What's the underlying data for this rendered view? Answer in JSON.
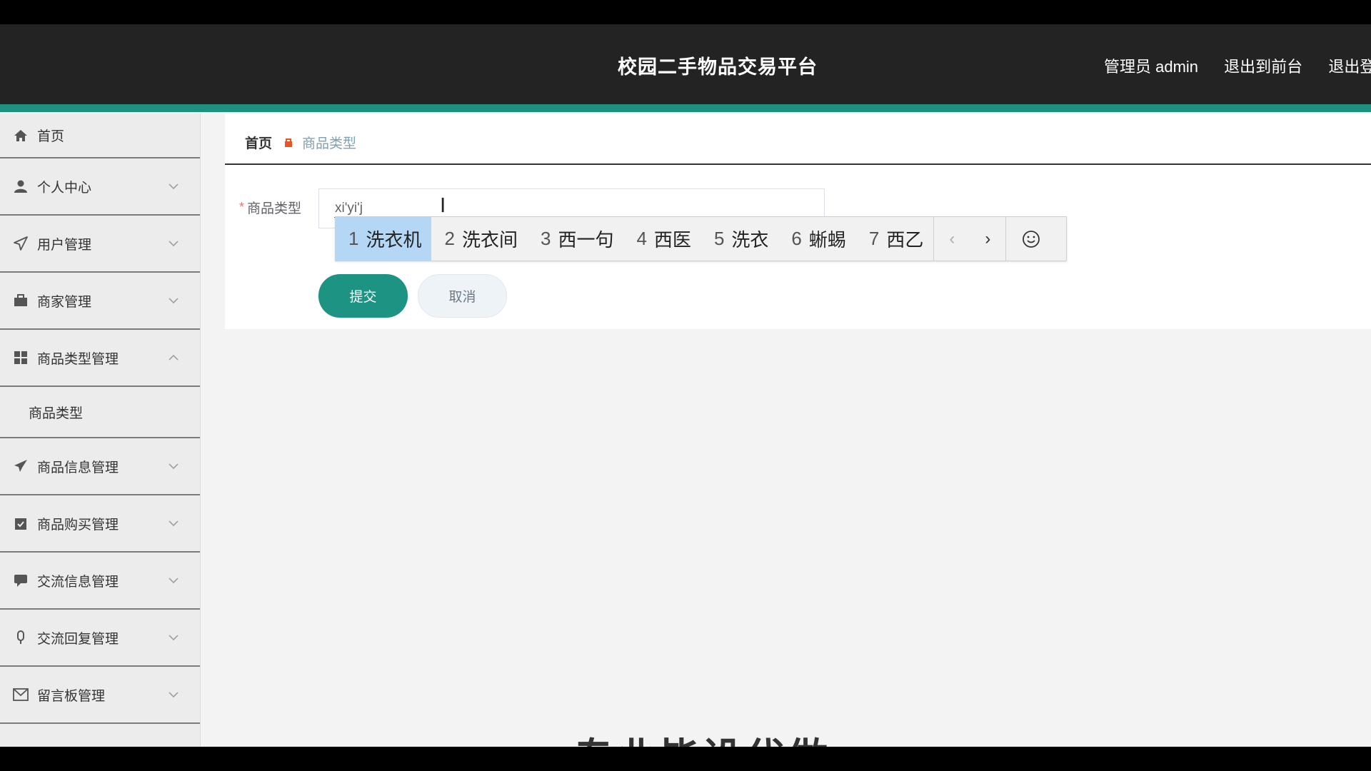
{
  "header": {
    "title": "校园二手物品交易平台",
    "admin_label": "管理员 admin",
    "exit_front_label": "退出到前台",
    "exit_label": "退出登录"
  },
  "sidebar": {
    "items": [
      {
        "label": "首页",
        "icon": "home-icon"
      },
      {
        "label": "个人中心",
        "icon": "user-icon"
      },
      {
        "label": "用户管理",
        "icon": "send-icon"
      },
      {
        "label": "商家管理",
        "icon": "briefcase-icon"
      },
      {
        "label": "商品类型管理",
        "icon": "grid-icon",
        "expanded": true
      },
      {
        "label": "商品类型",
        "submenu": true
      },
      {
        "label": "商品信息管理",
        "icon": "paper-plane-icon"
      },
      {
        "label": "商品购买管理",
        "icon": "clipboard-icon"
      },
      {
        "label": "交流信息管理",
        "icon": "chat-icon"
      },
      {
        "label": "交流回复管理",
        "icon": "mic-icon"
      },
      {
        "label": "留言板管理",
        "icon": "mail-icon"
      }
    ]
  },
  "breadcrumb": {
    "home": "首页",
    "current": "商品类型"
  },
  "form": {
    "required_mark": "*",
    "field_label": "商品类型",
    "input_value": "xi'yi'j",
    "submit_label": "提交",
    "cancel_label": "取消"
  },
  "ime": {
    "candidates": [
      {
        "num": "1",
        "text": "洗衣机"
      },
      {
        "num": "2",
        "text": "洗衣间"
      },
      {
        "num": "3",
        "text": "西一句"
      },
      {
        "num": "4",
        "text": "西医"
      },
      {
        "num": "5",
        "text": "洗衣"
      },
      {
        "num": "6",
        "text": "蜥蜴"
      },
      {
        "num": "7",
        "text": "西乙"
      }
    ],
    "prev": "‹",
    "next": "›"
  },
  "watermark": "专业毕设代做",
  "colors": {
    "header_bg": "#232323",
    "accent": "#1f8f80",
    "submit": "#1d9384",
    "ime_active": "#b4d7f6"
  }
}
